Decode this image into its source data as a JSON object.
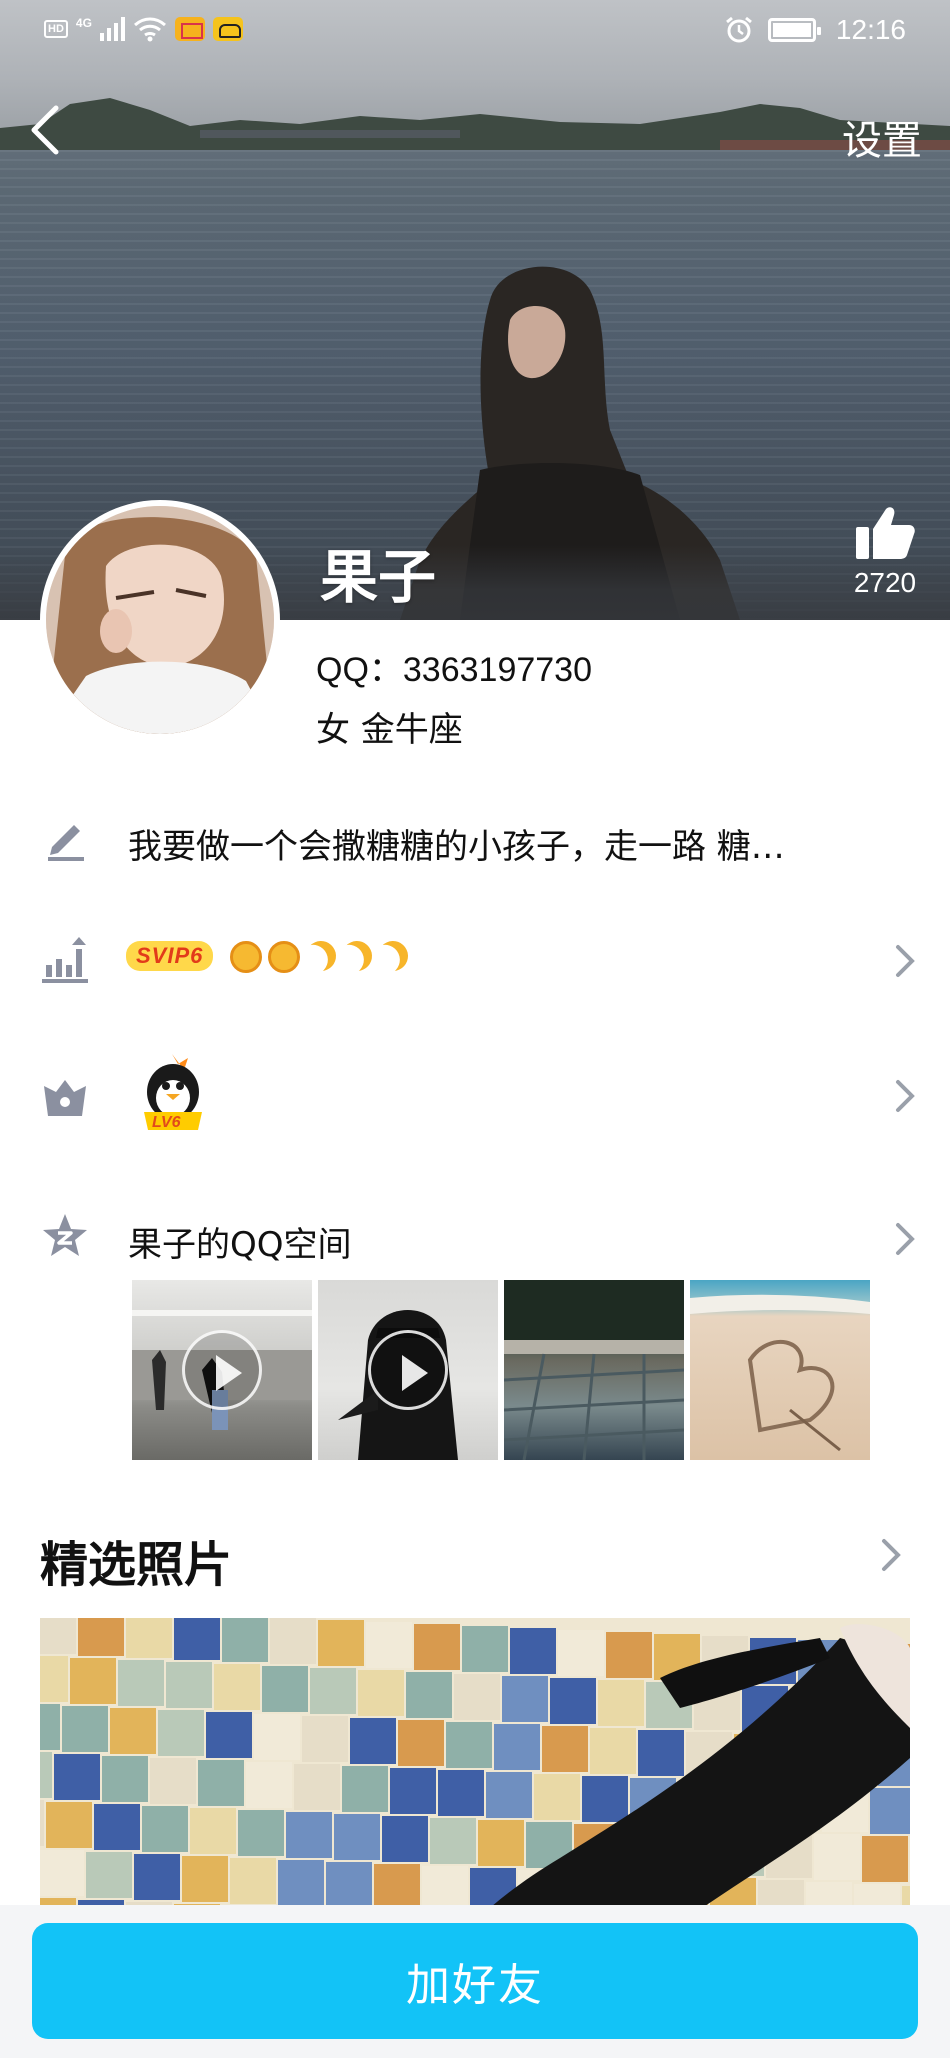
{
  "status_bar": {
    "network": "4G",
    "hd": "HD",
    "time": "12:16"
  },
  "nav": {
    "back_icon": "chevron-left-icon",
    "settings_label": "设置"
  },
  "profile": {
    "name": "果子",
    "qq_line": "QQ：3363197730",
    "info_line": "女  金牛座",
    "like_count": "2720"
  },
  "rows": {
    "signature": "我要做一个会撒糖糖的小孩子，走一路 糖…",
    "vip_badge": "SVIP6",
    "level_badge": "LV6",
    "qzone_title": "果子的QQ空间"
  },
  "featured": {
    "title": "精选照片"
  },
  "actions": {
    "add_friend": "加好友"
  },
  "colors": {
    "primary": "#12c3f7",
    "icon_gray": "#8b90a0"
  }
}
